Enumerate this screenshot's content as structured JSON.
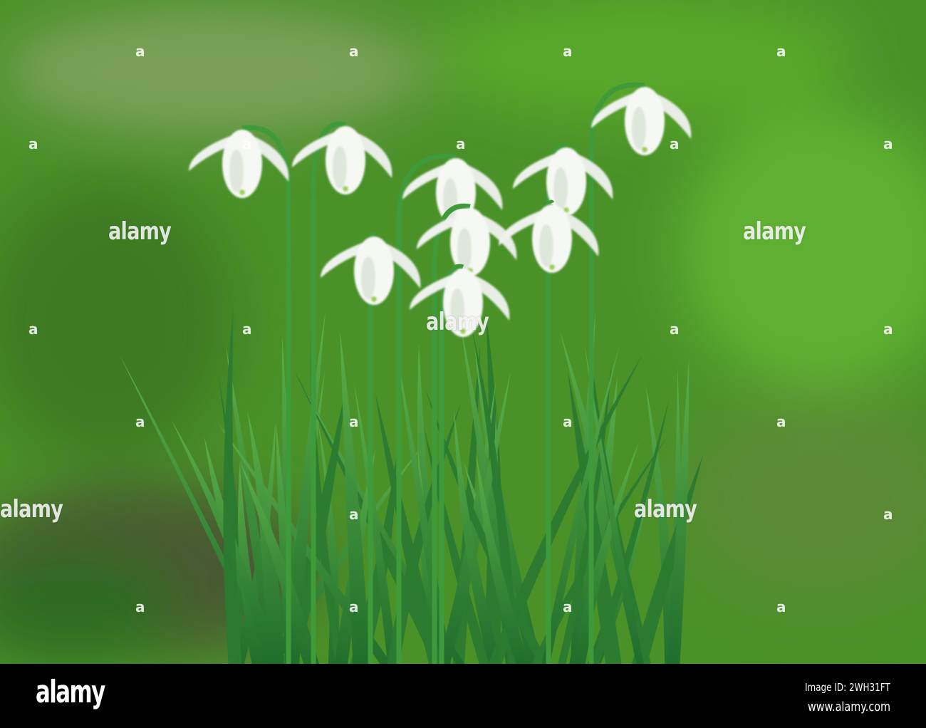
{
  "image": {
    "subject": "snowdrop-flowers",
    "background_color": "#4f9a2a",
    "leaf_color": "#2f8a35",
    "petal_color": "#f4f6f2"
  },
  "watermark": {
    "text": "alamy",
    "mark": "a"
  },
  "footer": {
    "logo": "alamy",
    "image_id": "Image ID: 2WH31FT",
    "website": "www.alamy.com"
  }
}
